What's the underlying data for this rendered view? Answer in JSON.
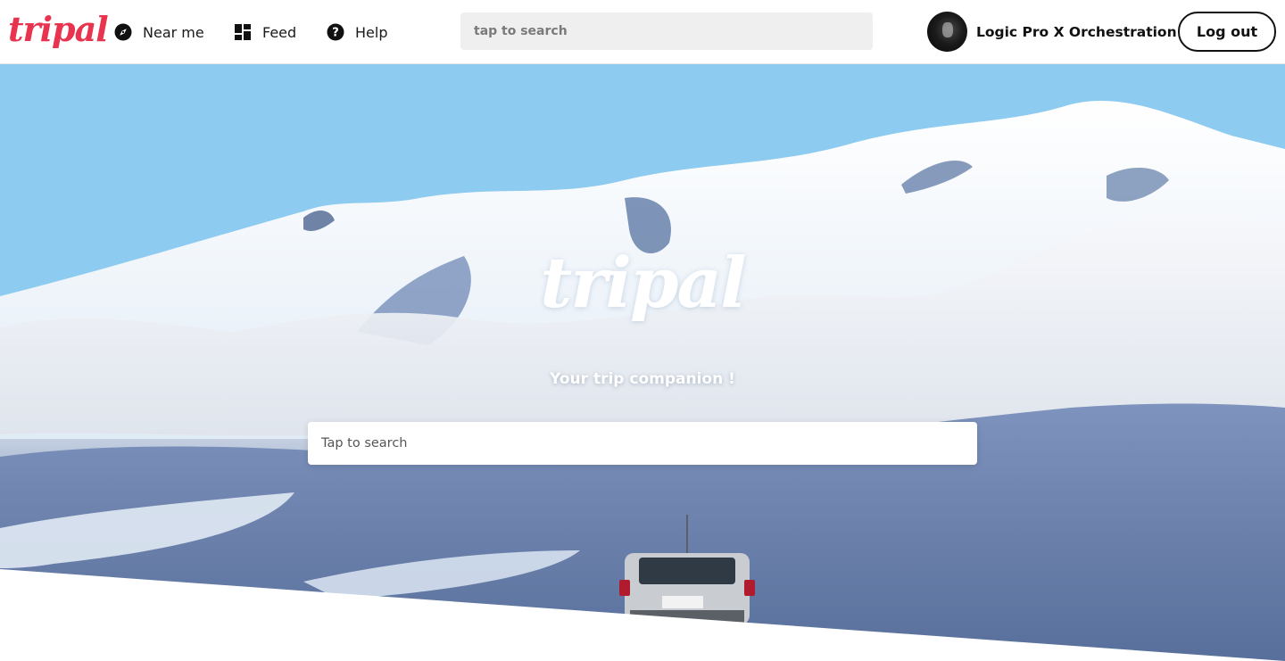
{
  "brand": {
    "logo_text": "tripal",
    "color": "#e8344f"
  },
  "nav": {
    "items": [
      {
        "label": "Near me",
        "icon": "compass-icon"
      },
      {
        "label": "Feed",
        "icon": "dashboard-icon"
      },
      {
        "label": "Help",
        "icon": "help-circle-icon"
      }
    ]
  },
  "search": {
    "placeholder": "tap to search"
  },
  "user": {
    "name": "Logic Pro X Orchestration",
    "avatar": "avatar"
  },
  "logout": {
    "label": "Log out"
  },
  "hero": {
    "logo_text": "tripal",
    "tagline": "Your trip companion !",
    "search_placeholder": "Tap to search"
  }
}
